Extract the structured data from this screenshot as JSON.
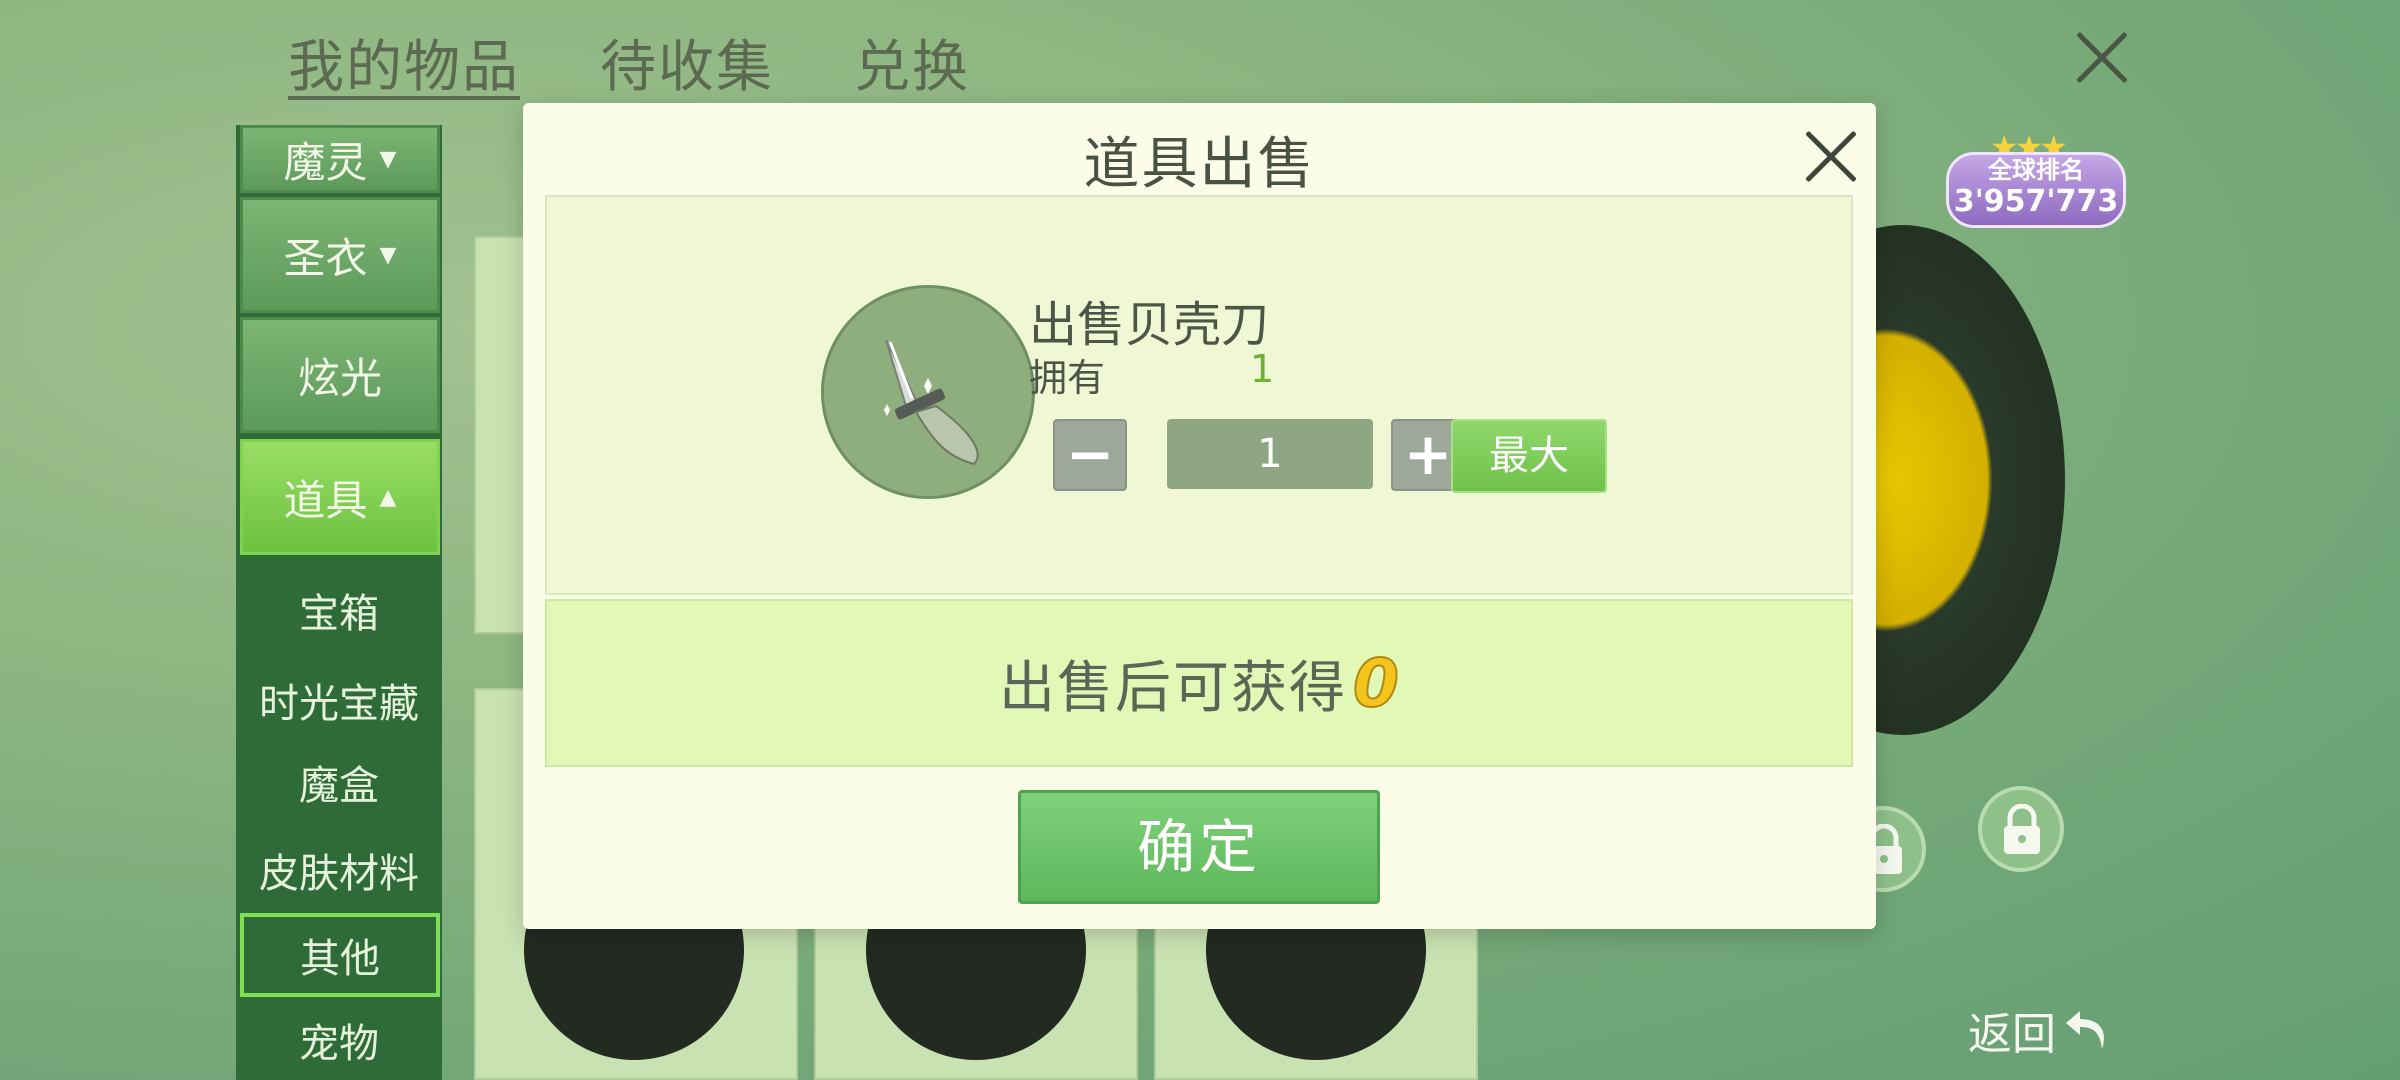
{
  "top_tabs": [
    "我的物品",
    "待收集",
    "兑换"
  ],
  "sidebar": {
    "categories": [
      {
        "label": "魔灵",
        "arrow": "▼"
      },
      {
        "label": "圣衣",
        "arrow": "▼"
      },
      {
        "label": "炫光",
        "arrow": ""
      },
      {
        "label": "道具",
        "arrow": "▲"
      }
    ],
    "sub_items": [
      "宝箱",
      "时光宝藏",
      "魔盒",
      "皮肤材料",
      "其他",
      "宠物"
    ],
    "selected_sub_item": "其他"
  },
  "rank_badge": {
    "label": "全球排名",
    "value": "3'957'773"
  },
  "back_label": "返回",
  "modal": {
    "title": "道具出售",
    "item_name": "出售贝壳刀",
    "own_label": "拥有",
    "own_value": "1",
    "minus_symbol": "−",
    "plus_symbol": "+",
    "quantity": "1",
    "max_label": "最大",
    "earn_label": "出售后可获得",
    "earn_value": "0",
    "confirm_label": "确定"
  },
  "icons": [
    "close-icon",
    "knife-icon",
    "lock-icon",
    "back-arrow-icon",
    "star-icon"
  ]
}
